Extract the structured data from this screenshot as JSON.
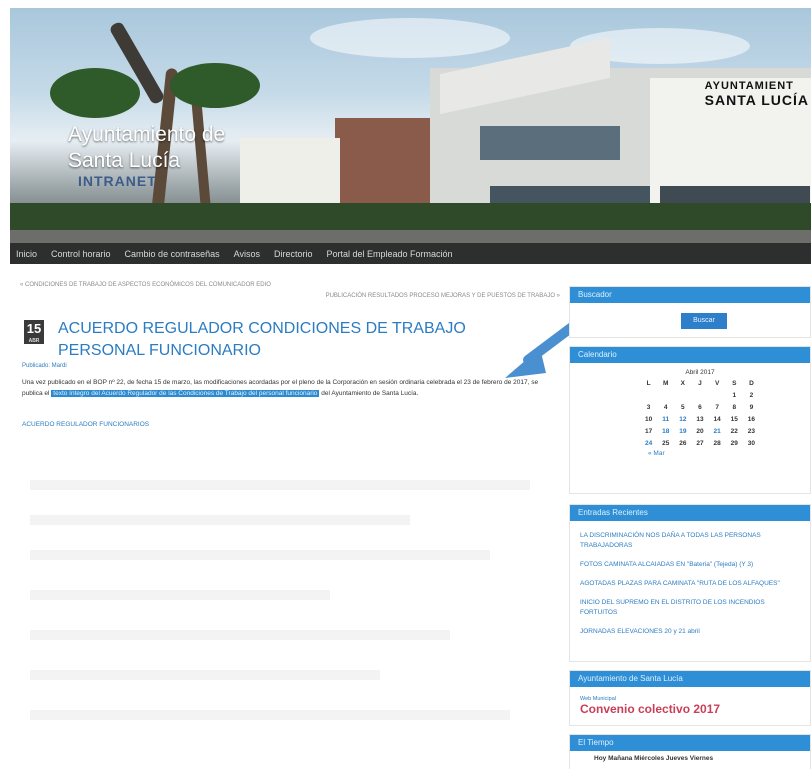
{
  "header": {
    "site_title_line1": "Ayuntamiento de",
    "site_title_line2": "Santa Lucía",
    "site_tagline": "INTRANET",
    "building_sign_line1": "AYUNTAMIENT",
    "building_sign_line2": "SANTA LUCÍA"
  },
  "nav": {
    "items": [
      "Inicio",
      "Control horario",
      "Cambio de contraseñas",
      "Avisos",
      "Directorio",
      "Portal del Empleado Formación"
    ]
  },
  "breadcrumbs": {
    "left": "« CONDICIONES DE TRABAJO DE ASPECTOS ECONÓMICOS DEL COMUNICADOR EDIO",
    "right": "PUBLICACIÓN RESULTADOS PROCESO MEJORAS Y DE PUESTOS DE TRABAJO »"
  },
  "post": {
    "day": "15",
    "month": "ABR",
    "title": "ACUERDO REGULADOR CONDICIONES DE TRABAJO PERSONAL FUNCIONARIO",
    "author": "Publicado: Mardi",
    "body_part1": "Una vez publicado en el BOP nº 22, de fecha 15 de marzo, las modificaciones acordadas por el pleno de la Corporación en sesión ordinaria celebrada el 23 de febrero de 2017, se publica el",
    "body_highlight": "texto íntegro del Acuerdo Regulador de las Condiciones de Trabajo del personal funcionario",
    "body_part2": "del Ayuntamiento de Santa Lucía.",
    "attachment_link": "ACUERDO REGULADOR FUNCIONARIOS"
  },
  "sidebar": {
    "search": {
      "title": "Buscador",
      "button_label": "Buscar",
      "placeholder": ""
    },
    "calendar": {
      "title": "Calendario",
      "caption": "Abril 2017",
      "weekdays": [
        "L",
        "M",
        "X",
        "J",
        "V",
        "S",
        "D"
      ],
      "weeks": [
        [
          "",
          "",
          "",
          "",
          "",
          "1",
          "2"
        ],
        [
          "3",
          "4",
          "5",
          "6",
          "7",
          "8",
          "9"
        ],
        [
          "10",
          "11",
          "12",
          "13",
          "14",
          "15",
          "16"
        ],
        [
          "17",
          "18",
          "19",
          "20",
          "21",
          "22",
          "23"
        ],
        [
          "24",
          "25",
          "26",
          "27",
          "28",
          "29",
          "30"
        ]
      ],
      "prev_link": "« Mar"
    },
    "recent": {
      "title": "Entradas Recientes",
      "items": [
        "LA DISCRIMINACIÓN NOS DAÑA A TODAS LAS PERSONAS TRABAJADORAS",
        "FOTOS CAMINATA ALCAIADAS EN \"Bateria\" (Tejeda) (Y 3)",
        "AGOTADAS PLAZAS PARA CAMINATA \"RUTA DE LOS ALFAQUES\"",
        "INICIO DEL SUPREMO EN EL DISTRITO DE LOS INCENDIOS FORTUITOS",
        "JORNADAS ELEVACIONES 20 y 21 abril"
      ]
    },
    "convenio": {
      "title": "Ayuntamiento de Santa Lucía",
      "small_link": "Web Municipal",
      "big_link": "Convenio colectivo 2017"
    },
    "weather": {
      "title": "El Tiempo",
      "days": "Hoy     Mañana  Miércoles  Jueves  Viernes"
    }
  },
  "colors": {
    "accent": "#2e8fd6",
    "link": "#2b7cc2",
    "nav_bg": "#2d2f2f",
    "convenio": "#c73f58"
  }
}
